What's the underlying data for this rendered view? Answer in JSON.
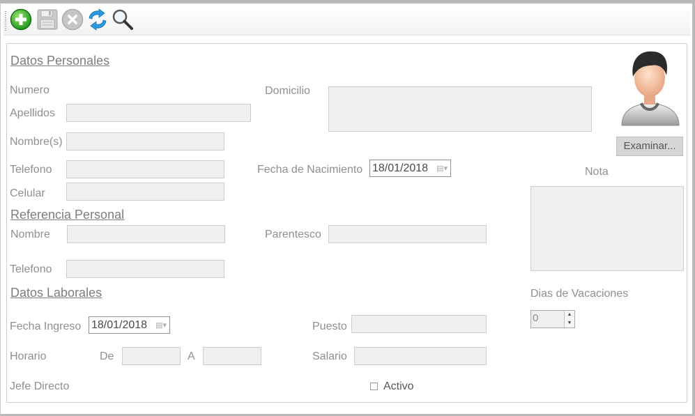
{
  "toolbar": {
    "icons": [
      "add-icon",
      "save-icon",
      "delete-icon",
      "refresh-icon",
      "search-icon"
    ]
  },
  "sections": {
    "personal": "Datos Personales",
    "reference": "Referencia Personal",
    "work": "Datos Laborales"
  },
  "labels": {
    "numero": "Numero",
    "apellidos": "Apellidos",
    "nombres": "Nombre(s)",
    "telefono": "Telefono",
    "celular": "Celular",
    "domicilio": "Domicilio",
    "fecha_nacimiento": "Fecha de Nacimiento",
    "ref_nombre": "Nombre",
    "parentesco": "Parentesco",
    "ref_telefono": "Telefono",
    "fecha_ingreso": "Fecha Ingreso",
    "puesto": "Puesto",
    "horario": "Horario",
    "de": "De",
    "a": "A",
    "salario": "Salario",
    "jefe_directo": "Jefe Directo",
    "activo": "Activo",
    "nota": "Nota",
    "dias_vacaciones": "Dias de Vacaciones"
  },
  "values": {
    "fecha_nacimiento": "18/01/2018",
    "fecha_ingreso": "18/01/2018",
    "dias_vacaciones": "0",
    "activo_checked": false
  },
  "buttons": {
    "examinar": "Examinar..."
  }
}
